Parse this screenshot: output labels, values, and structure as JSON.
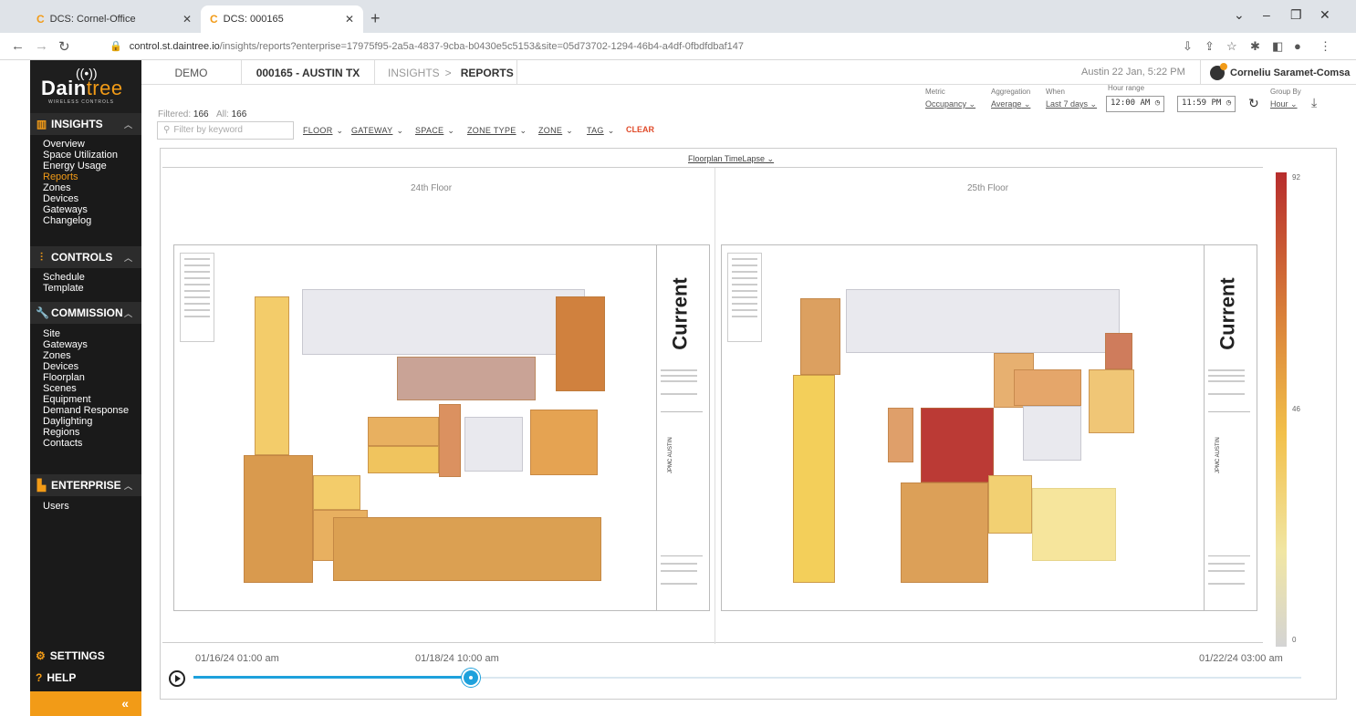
{
  "browser": {
    "tabs": [
      {
        "title": "DCS: Cornel-Office",
        "active": false
      },
      {
        "title": "DCS: 000165",
        "active": true
      }
    ],
    "url_host": "control.st.daintree.io",
    "url_rest": "/insights/reports?enterprise=17975f95-2a5a-4837-9cba-b0430e5c5153&site=05d73702-1294-46b4-a4df-0fbdfdbaf147"
  },
  "sidebar": {
    "logo": "Daintree",
    "logo_sub": "WIRELESS CONTROLS",
    "sections": [
      {
        "title": "INSIGHTS",
        "items": [
          "Overview",
          "Space Utilization",
          "Energy Usage",
          "Reports",
          "Zones",
          "Devices",
          "Gateways",
          "Changelog"
        ],
        "active_item": "Reports"
      },
      {
        "title": "CONTROLS",
        "items": [
          "Schedule",
          "Template"
        ]
      },
      {
        "title": "COMMISSION",
        "items": [
          "Site",
          "Gateways",
          "Zones",
          "Devices",
          "Floorplan",
          "Scenes",
          "Equipment",
          "Demand Response",
          "Daylighting",
          "Regions",
          "Contacts"
        ]
      },
      {
        "title": "ENTERPRISE",
        "items": [
          "Users"
        ]
      }
    ],
    "settings": "SETTINGS",
    "help": "HELP",
    "collapse": "«"
  },
  "header": {
    "org": "DEMO",
    "site": "000165 - AUSTIN TX",
    "crumb_parent": "INSIGHTS",
    "crumb_current": "REPORTS",
    "datetime": "Austin 22 Jan, 5:22 PM",
    "user": "Corneliu Saramet-Comsa"
  },
  "filters": {
    "filtered_label": "Filtered:",
    "filtered_count": "166",
    "all_label": "All:",
    "all_count": "166",
    "search_placeholder": "Filter by keyword",
    "dropdowns": [
      "FLOOR",
      "GATEWAY",
      "SPACE",
      "ZONE TYPE",
      "ZONE",
      "TAG"
    ],
    "clear": "CLEAR"
  },
  "controls": {
    "metric_label": "Metric",
    "metric": "Occupancy",
    "aggregation_label": "Aggregation",
    "aggregation": "Average",
    "when_label": "When",
    "when": "Last 7 days",
    "hour_range_label": "Hour range",
    "hour_start": "12:00 AM",
    "hour_end": "11:59 PM",
    "group_by_label": "Group By",
    "group_by": "Hour"
  },
  "view": {
    "selector": "Floorplan TimeLapse",
    "floors": [
      {
        "title": "24th Floor"
      },
      {
        "title": "25th Floor"
      }
    ],
    "brand_mark": "Current",
    "sheet_label": "JPMC AUSTIN",
    "legend": {
      "max": "92",
      "mid": "46",
      "min": "0"
    },
    "colors": {
      "high": "#b72d2d",
      "mid": "#f2c04a",
      "low": "#d4d4d4"
    }
  },
  "timeline": {
    "start": "01/16/24 01:00 am",
    "current": "01/18/24 10:00 am",
    "end": "01/22/24 03:00 am",
    "progress": 0.25
  }
}
